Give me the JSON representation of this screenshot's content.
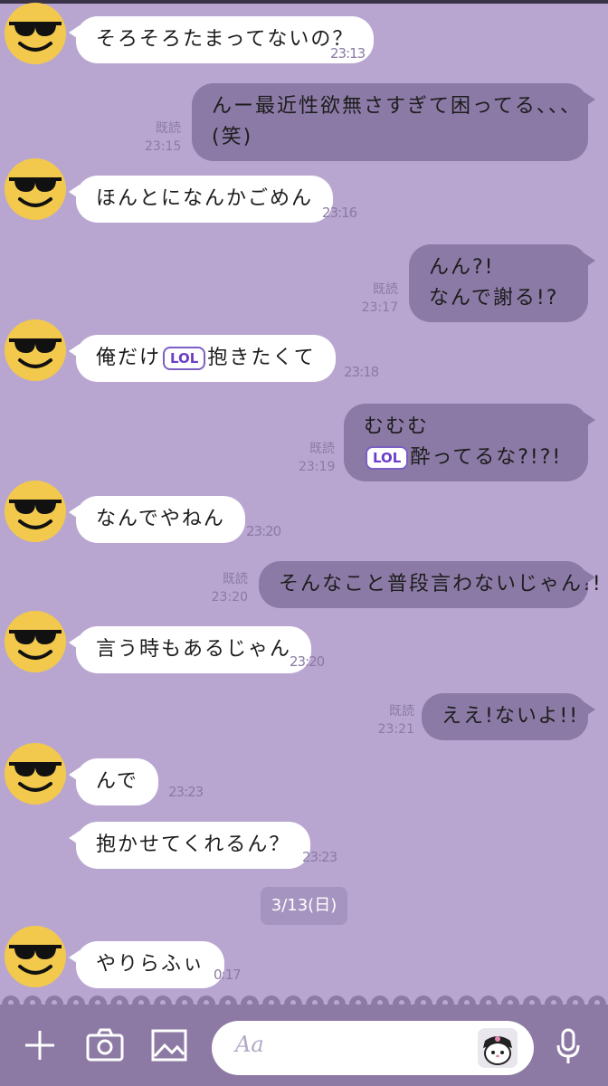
{
  "colors": {
    "background": "#b8a6d1",
    "incoming_bubble": "#ffffff",
    "outgoing_bubble": "#8b7aa6",
    "input_bar": "#8c7aa4",
    "sticker_accent": "#6a3fc7"
  },
  "avatar_icon": "sunglasses-emoji-avatar",
  "sticker_text": "LOL",
  "messages": [
    {
      "side": "left",
      "text": "そろそろたまってないの？",
      "time": "23:13"
    },
    {
      "side": "right",
      "line1": "んー最近性欲無さすぎて困ってる、、、",
      "line2": "(笑)",
      "read": "既読",
      "time": "23:15"
    },
    {
      "side": "left",
      "text": "ほんとになんかごめん",
      "time": "23:16"
    },
    {
      "side": "right",
      "line1": "んん?!",
      "line2": "なんで謝る!?",
      "read": "既読",
      "time": "23:17"
    },
    {
      "side": "left",
      "before": "俺だけ",
      "after": "抱きたくて",
      "time": "23:18"
    },
    {
      "side": "right",
      "line1": "むむむ",
      "after": "酔ってるな?!?!",
      "read": "既読",
      "time": "23:19"
    },
    {
      "side": "left",
      "text": "なんでやねん",
      "time": "23:20"
    },
    {
      "side": "right",
      "text": "そんなこと普段言わないじゃん!!",
      "read": "既読",
      "time": "23:20"
    },
    {
      "side": "left",
      "text": "言う時もあるじゃん",
      "time": "23:20"
    },
    {
      "side": "right",
      "text": "ええ!ないよ!!",
      "read": "既読",
      "time": "23:21"
    },
    {
      "side": "left",
      "text": "んで",
      "time": "23:23"
    },
    {
      "side": "left",
      "text": "抱かせてくれるん？",
      "time": "23:23"
    },
    {
      "side": "left",
      "text": "やりらふぃ",
      "time": "0:17"
    }
  ],
  "date_separator": "3/13(日)",
  "input": {
    "placeholder": "Aa",
    "icons": [
      "plus-icon",
      "camera-icon",
      "image-icon",
      "sticker-icon",
      "microphone-icon"
    ]
  }
}
